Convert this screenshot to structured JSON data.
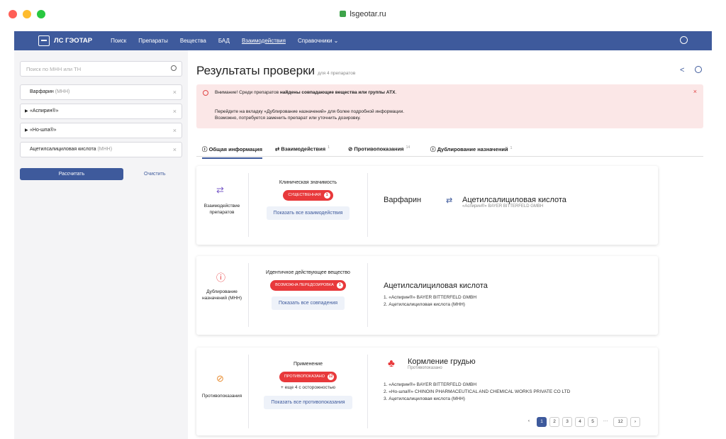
{
  "browser": {
    "url": "lsgeotar.ru"
  },
  "nav": {
    "brand": "ЛС ГЭОТАР",
    "links": [
      "Поиск",
      "Препараты",
      "Вещества",
      "БАД",
      "Взаимодействия",
      "Справочники ⌄"
    ]
  },
  "sidebar": {
    "search_placeholder": "Поиск по МНН или ТН",
    "drugs": [
      {
        "name": "Варфарин",
        "note": "(МНН)"
      },
      {
        "name": "«Аспирин®»",
        "note": ""
      },
      {
        "name": "«Но-шпа®»",
        "note": ""
      },
      {
        "name": "Ацетилсалициловая кислота",
        "note": "(МНН)"
      }
    ],
    "calc": "Рассчитать",
    "clear": "Очистить"
  },
  "main": {
    "title": "Результаты проверки",
    "subtitle": "для 4 препаратов",
    "alert": {
      "line1a": "Внимание! Среди препаратов ",
      "line1b": "найдены совпадающие вещества или группы АТХ",
      "line1c": ".",
      "line2": "Перейдите на вкладку «Дублирование назначений» для более подробной информации. Возможно, потребуется заменить препарат или уточнить дозировку."
    },
    "tabs": [
      {
        "label": "Общая информация",
        "count": ""
      },
      {
        "label": "Взаимодействия",
        "count": "1"
      },
      {
        "label": "Противопоказания",
        "count": "14"
      },
      {
        "label": "Дублирование назначений",
        "count": "1"
      }
    ]
  },
  "cards": {
    "interaction": {
      "label": "Взаимодействие препаратов",
      "title": "Клиническая значимость",
      "pill": "СУЩЕСТВЕННАЯ",
      "count": "1",
      "button": "Показать все взаимодействия",
      "left": "Варфарин",
      "right": "Ацетилсалициловая кислота",
      "right_sub": "«Аспирин®» BAYER BITTERFELD GMBH"
    },
    "duplicate": {
      "label": "Дублирование назначений (МНН)",
      "title": "Идентичное действующее вещество",
      "pill": "ВОЗМОЖНА ПЕРЕДОЗИРОВКА",
      "count": "1",
      "button": "Показать все совпадения",
      "heading": "Ацетилсалициловая кислота",
      "items": [
        "1. «Аспирин®» BAYER BITTERFELD GMBH",
        "2. Ацетилсалициловая кислота (МНН)"
      ]
    },
    "contra": {
      "label": "Противопоказания",
      "title": "Применение",
      "pill": "ПРОТИВОПОКАЗАНО",
      "count": "12",
      "more": "+ еще 4 с осторожностью",
      "button": "Показать все противопоказания",
      "heading": "Кормление грудью",
      "heading_sub": "Противопоказано",
      "items": [
        "1. «Аспирин®» BAYER BITTERFELD GMBH",
        "2. «Но-шпа®» CHINOIN PHARMACEUTICAL AND CHEMICAL WORKS PRIVATE CO LTD",
        "3. Ацетилсалициловая кислота (МНН)"
      ],
      "pages": [
        "‹",
        "1",
        "2",
        "3",
        "4",
        "5",
        "···",
        "12",
        "›"
      ]
    }
  },
  "colors": {
    "brand": "#3e5a9c",
    "danger": "#e8393b",
    "alert_bg": "#fbe7e7"
  }
}
